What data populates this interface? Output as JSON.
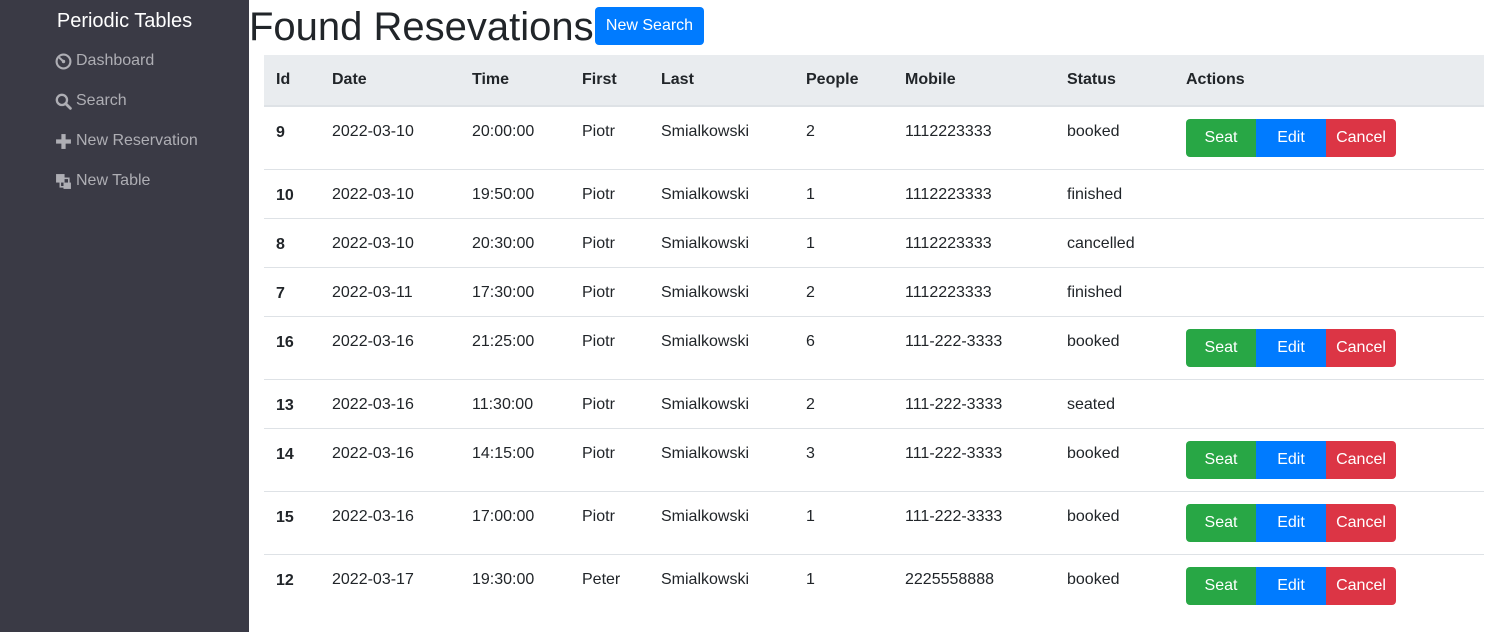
{
  "sidebar": {
    "brand": "Periodic Tables",
    "items": [
      {
        "label": "Dashboard",
        "icon": "dashboard-icon"
      },
      {
        "label": "Search",
        "icon": "search-icon"
      },
      {
        "label": "New Reservation",
        "icon": "plus-icon"
      },
      {
        "label": "New Table",
        "icon": "layers-icon"
      }
    ]
  },
  "page": {
    "title": "Found Resevations",
    "new_search_label": "New Search"
  },
  "table": {
    "headers": [
      "Id",
      "Date",
      "Time",
      "First",
      "Last",
      "People",
      "Mobile",
      "Status",
      "Actions"
    ],
    "action_labels": {
      "seat": "Seat",
      "edit": "Edit",
      "cancel": "Cancel"
    },
    "rows": [
      {
        "id": "9",
        "date": "2022-03-10",
        "time": "20:00:00",
        "first": "Piotr",
        "last": "Smialkowski",
        "people": "2",
        "mobile": "1112223333",
        "status": "booked"
      },
      {
        "id": "10",
        "date": "2022-03-10",
        "time": "19:50:00",
        "first": "Piotr",
        "last": "Smialkowski",
        "people": "1",
        "mobile": "1112223333",
        "status": "finished"
      },
      {
        "id": "8",
        "date": "2022-03-10",
        "time": "20:30:00",
        "first": "Piotr",
        "last": "Smialkowski",
        "people": "1",
        "mobile": "1112223333",
        "status": "cancelled"
      },
      {
        "id": "7",
        "date": "2022-03-11",
        "time": "17:30:00",
        "first": "Piotr",
        "last": "Smialkowski",
        "people": "2",
        "mobile": "1112223333",
        "status": "finished"
      },
      {
        "id": "16",
        "date": "2022-03-16",
        "time": "21:25:00",
        "first": "Piotr",
        "last": "Smialkowski",
        "people": "6",
        "mobile": "111-222-3333",
        "status": "booked"
      },
      {
        "id": "13",
        "date": "2022-03-16",
        "time": "11:30:00",
        "first": "Piotr",
        "last": "Smialkowski",
        "people": "2",
        "mobile": "111-222-3333",
        "status": "seated"
      },
      {
        "id": "14",
        "date": "2022-03-16",
        "time": "14:15:00",
        "first": "Piotr",
        "last": "Smialkowski",
        "people": "3",
        "mobile": "111-222-3333",
        "status": "booked"
      },
      {
        "id": "15",
        "date": "2022-03-16",
        "time": "17:00:00",
        "first": "Piotr",
        "last": "Smialkowski",
        "people": "1",
        "mobile": "111-222-3333",
        "status": "booked"
      },
      {
        "id": "12",
        "date": "2022-03-17",
        "time": "19:30:00",
        "first": "Peter",
        "last": "Smialkowski",
        "people": "1",
        "mobile": "2225558888",
        "status": "booked"
      }
    ]
  },
  "colors": {
    "sidebar_bg": "#3a3a45",
    "primary": "#007bff",
    "success": "#28a745",
    "danger": "#dc3545",
    "header_bg": "#e9ecef"
  }
}
